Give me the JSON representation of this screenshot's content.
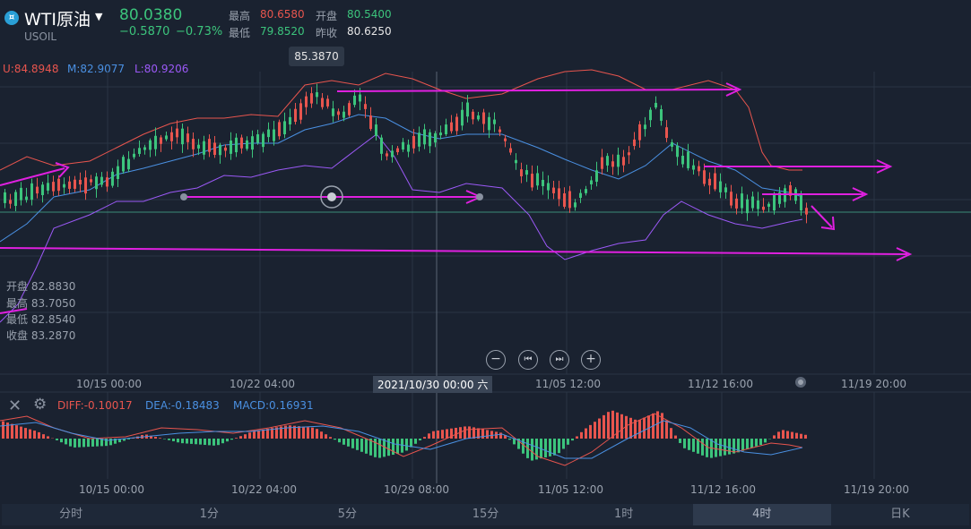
{
  "instrument": {
    "name": "WTI原油",
    "symbol": "USOIL",
    "price": "80.0380",
    "change": "−0.5870",
    "change_pct": "−0.73%",
    "high_label": "最高",
    "high": "80.6580",
    "open_label": "开盘",
    "open": "80.5400",
    "low_label": "最低",
    "low": "79.8520",
    "prev_label": "昨收",
    "prev_close": "80.6250"
  },
  "indicators": {
    "upper": "U:84.8948",
    "middle": "M:82.9077",
    "lower": "L:80.9206"
  },
  "tooltip_high": "85.3870",
  "hover_ohlc": {
    "open": "开盘 82.8830",
    "high": "最高 83.7050",
    "low": "最低 82.8540",
    "close": "收盘 83.2870"
  },
  "controls": {
    "zoom_out": "−",
    "prev": "⏮",
    "next": "⏭",
    "zoom_in": "+"
  },
  "main_x_labels": [
    "10/15 00:00",
    "10/22 04:00",
    "11/05 12:00",
    "11/12 16:00",
    "11/19 20:00"
  ],
  "crosshair_date": "2021/10/30 00:00 六",
  "macd": {
    "diff": "DIFF:-0.10017",
    "dea": "DEA:-0.18483",
    "macd": "MACD:0.16931"
  },
  "macd_x_labels": [
    "10/15 00:00",
    "10/22 04:00",
    "10/29 08:00",
    "11/05 12:00",
    "11/12 16:00",
    "11/19 20:00"
  ],
  "timeframes": [
    "分时",
    "1分",
    "5分",
    "15分",
    "1时",
    "4时",
    "日K"
  ],
  "active_timeframe": "4时",
  "colors": {
    "up": "#e8554e",
    "down": "#3cc47c",
    "upper_band": "#e8554e",
    "mid_band": "#4a90e2",
    "lower_band": "#9b59f6",
    "annotation": "#e020e0"
  }
}
